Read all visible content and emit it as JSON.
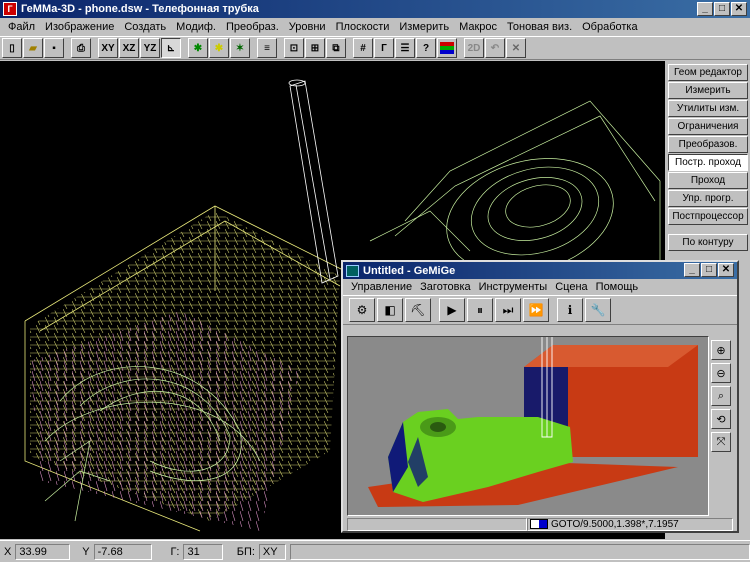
{
  "window": {
    "title": "ГеММа-3D - phone.dsw - Телефонная трубка",
    "min": "_",
    "max": "□",
    "close": "✕",
    "app_icon": "Г"
  },
  "menu": [
    "Файл",
    "Изображение",
    "Создать",
    "Модиф.",
    "Преобраз.",
    "Уровни",
    "Плоскости",
    "Измерить",
    "Макрос",
    "Тоновая виз.",
    "Обработка"
  ],
  "toolbar": {
    "xy": "XY",
    "xz": "XZ",
    "yz": "YZ",
    "gamma": "Г",
    "twod": "2D"
  },
  "panel": [
    "Геом редактор",
    "Измерить",
    "Утилиты изм.",
    "Ограничения",
    "Преобразов.",
    "Постр. проход",
    "Проход",
    "Упр. прогр.",
    "Постпроцессор",
    "По контуру"
  ],
  "status": {
    "x_label": "X",
    "x_value": "33.99",
    "y_label": "Y",
    "y_value": "-7.68",
    "g_label": "Г:",
    "g_value": "31",
    "bp_label": "БП:",
    "bp_value": "XY"
  },
  "subwindow": {
    "title": "Untitled - GeMiGe",
    "menu": [
      "Управление",
      "Заготовка",
      "Инструменты",
      "Сцена",
      "Помощь"
    ],
    "status": "GOTO/9.5000,1.398*,7.1957"
  },
  "colors": {
    "title_bar": "#0a246a",
    "wire_green": "#c8f0a0",
    "wire_yellow": "#e8e87a",
    "wire_pink": "#f0a0d8",
    "stock_red": "#c83a14",
    "part_green": "#6ad020",
    "part_blue": "#101a78"
  }
}
